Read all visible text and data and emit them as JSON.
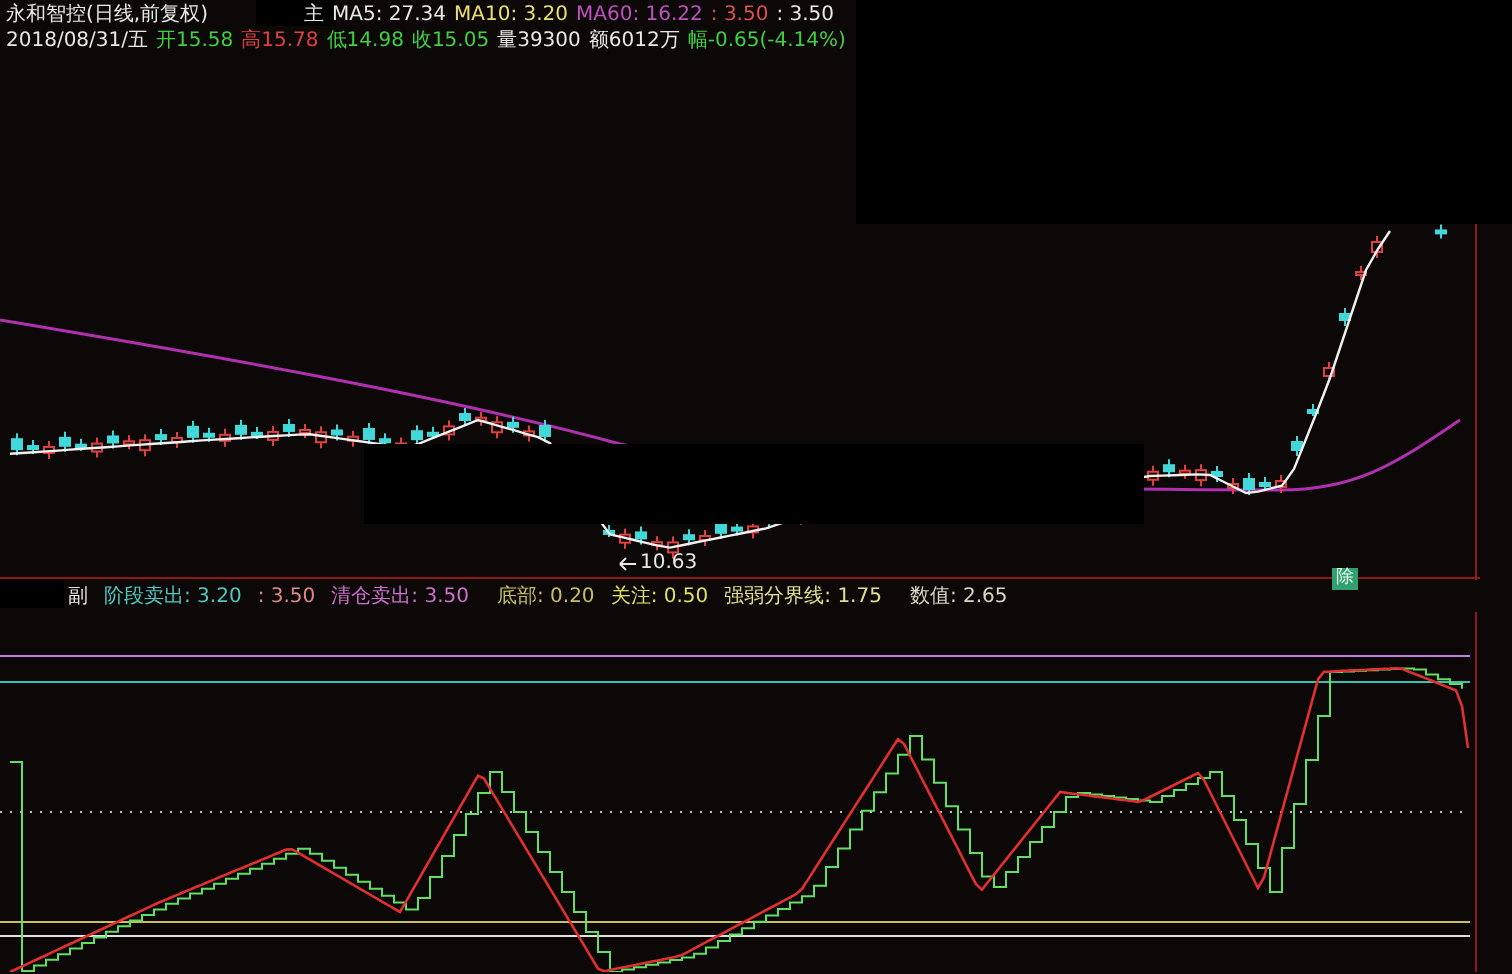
{
  "quote_header": {
    "title": "永和智控(日线,前复权)",
    "title_suffix": "主",
    "indicators": [
      {
        "label": "MA5: 27.34",
        "color": "#e8e8e8"
      },
      {
        "label": "MA10: 3.20",
        "color": "#e8e070"
      },
      {
        "label": "MA60: 16.22",
        "color": "#c050c0"
      },
      {
        "label": ": 3.50",
        "color": "#e05050"
      },
      {
        "label": ": 3.50",
        "color": "#e8e8e8"
      }
    ]
  },
  "quote_line": [
    {
      "text": "2018/08/31/五",
      "color": "#e8e8e8"
    },
    {
      "text": "开15.58",
      "color": "#40d040"
    },
    {
      "text": "高15.78",
      "color": "#e04040"
    },
    {
      "text": "低14.98",
      "color": "#40d040"
    },
    {
      "text": "收15.05",
      "color": "#40d040"
    },
    {
      "text": "量39300",
      "color": "#e8e8e8"
    },
    {
      "text": "额6012万",
      "color": "#e8e8e8"
    },
    {
      "text": "幅-0.65(-4.14%)",
      "color": "#40d040"
    }
  ],
  "price_label": "10.63",
  "event_marker": "除",
  "sub_chart": {
    "prefix": "副",
    "legend": [
      {
        "text": "阶段卖出: 3.20",
        "color": "#50c8c0"
      },
      {
        "text": ": 3.50",
        "color": "#e08888"
      },
      {
        "text": "清仓卖出: 3.50",
        "color": "#d070d0"
      },
      {
        "text": "底部: 0.20",
        "color": "#c8c060"
      },
      {
        "text": "关注: 0.50",
        "color": "#e0e060"
      },
      {
        "text": "强弱分界线: 1.75",
        "color": "#e0e090"
      },
      {
        "text": "数值: 2.65",
        "color": "#d8d8c0"
      }
    ]
  }
}
